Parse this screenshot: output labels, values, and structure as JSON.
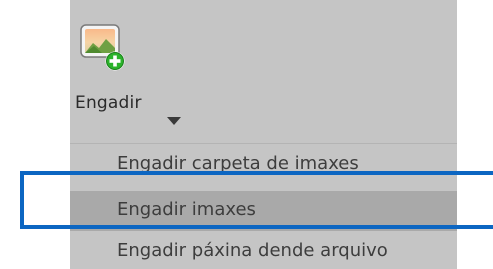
{
  "toolbar": {
    "add_button": {
      "label": "Engadir",
      "icon": "add-image-icon",
      "dropdown_icon": "caret-down-icon"
    }
  },
  "menu": {
    "items": [
      {
        "label": "Engadir carpeta de imaxes",
        "state": "normal"
      },
      {
        "label": "Engadir imaxes",
        "state": "hovered"
      },
      {
        "label": "Engadir páxina dende arquivo",
        "state": "normal"
      }
    ]
  },
  "highlight": {
    "target": "Engadir imaxes",
    "color": "#0c66c2"
  },
  "colors": {
    "panel_bg": "#c5c5c5",
    "hover_bg": "#a9a9a9",
    "text": "#3d3d3d",
    "icon_plus": "#2bb32b"
  }
}
